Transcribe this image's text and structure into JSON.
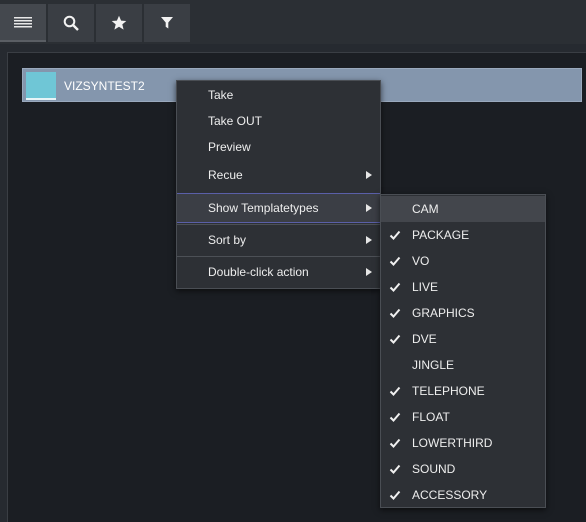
{
  "toolbar": {
    "buttons": [
      {
        "icon": "hamburger-menu-icon"
      },
      {
        "icon": "search-icon"
      },
      {
        "icon": "star-icon"
      },
      {
        "icon": "filter-icon"
      }
    ]
  },
  "playlist": {
    "rows": [
      {
        "label": "VIZSYNTEST2",
        "thumb_color": "#6fc6d6"
      }
    ]
  },
  "context_menu": {
    "items": [
      {
        "label": "Take"
      },
      {
        "label": "Take OUT"
      },
      {
        "label": "Preview"
      },
      {
        "label": "Recue"
      },
      {
        "label": "Show Templatetypes"
      },
      {
        "label": "Sort by"
      },
      {
        "label": "Double-click action"
      }
    ]
  },
  "submenu": {
    "items": [
      {
        "label": "CAM",
        "checked": false
      },
      {
        "label": "PACKAGE",
        "checked": true
      },
      {
        "label": "VO",
        "checked": true
      },
      {
        "label": "LIVE",
        "checked": true
      },
      {
        "label": "GRAPHICS",
        "checked": true
      },
      {
        "label": "DVE",
        "checked": true
      },
      {
        "label": "JINGLE",
        "checked": false
      },
      {
        "label": "TELEPHONE",
        "checked": true
      },
      {
        "label": "FLOAT",
        "checked": true
      },
      {
        "label": "LOWERTHIRD",
        "checked": true
      },
      {
        "label": "SOUND",
        "checked": true
      },
      {
        "label": "ACCESSORY",
        "checked": true
      }
    ]
  },
  "colors": {
    "background": "#262a30",
    "row_selected": "#8496ad",
    "menu_bg": "#2d3035",
    "highlight_border": "#5a5fa8"
  }
}
